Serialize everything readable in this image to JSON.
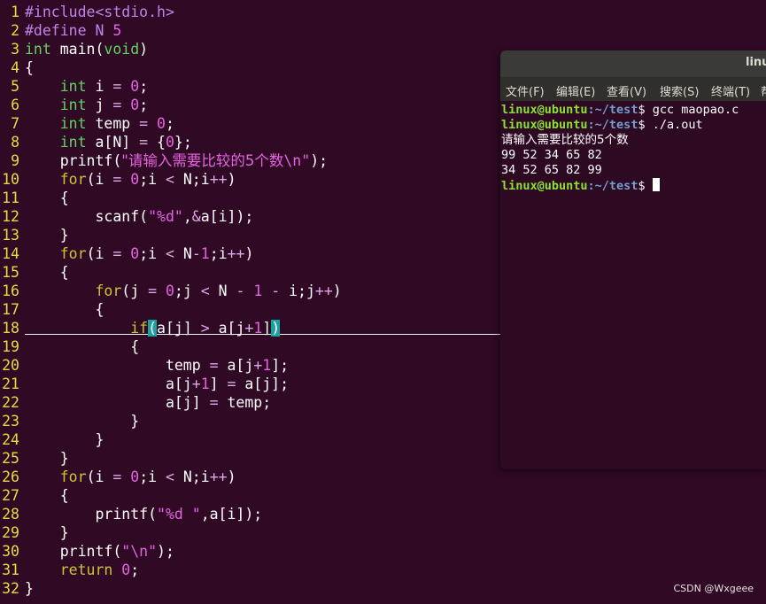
{
  "editor": {
    "line_numbers": [
      "1",
      "2",
      "3",
      "4",
      "5",
      "6",
      "7",
      "8",
      "9",
      "10",
      "11",
      "12",
      "13",
      "14",
      "15",
      "16",
      "17",
      "18",
      "19",
      "20",
      "21",
      "22",
      "23",
      "24",
      "25",
      "26",
      "27",
      "28",
      "29",
      "30",
      "31",
      "32"
    ],
    "code": {
      "l1": [
        "#include",
        "<stdio.h>"
      ],
      "l2": [
        "#define",
        " N ",
        "5"
      ],
      "l3": [
        "int",
        " main(",
        "void",
        ")"
      ],
      "l4": [
        "{"
      ],
      "l5": [
        "    ",
        "int",
        " i ",
        "=",
        " ",
        "0",
        ";"
      ],
      "l6": [
        "    ",
        "int",
        " j ",
        "=",
        " ",
        "0",
        ";"
      ],
      "l7": [
        "    ",
        "int",
        " temp ",
        "=",
        " ",
        "0",
        ";"
      ],
      "l8": [
        "    ",
        "int",
        " a[N] ",
        "=",
        " {",
        "0",
        "};"
      ],
      "l9": [
        "    printf(",
        "\"请输入需要比较的5个数",
        "\\n",
        "\"",
        ");"
      ],
      "l10": [
        "    ",
        "for",
        "(i ",
        "=",
        " ",
        "0",
        ";i ",
        "<",
        " N;i",
        "++",
        ")"
      ],
      "l11": [
        "    {"
      ],
      "l12": [
        "        scanf(",
        "\"%d\"",
        ",",
        "&",
        "a[i]);"
      ],
      "l13": [
        "    }"
      ],
      "l14": [
        "    ",
        "for",
        "(i ",
        "=",
        " ",
        "0",
        ";i ",
        "<",
        " N",
        "-",
        "1",
        ";i",
        "++",
        ")"
      ],
      "l15": [
        "    {"
      ],
      "l16": [
        "        ",
        "for",
        "(j ",
        "=",
        " ",
        "0",
        ";j ",
        "<",
        " N ",
        "-",
        " ",
        "1",
        " ",
        "-",
        " i;j",
        "++",
        ")"
      ],
      "l17": [
        "        {"
      ],
      "l18": [
        "            ",
        "if",
        "(",
        "a[j] ",
        ">",
        " a[j",
        "+",
        "1",
        "]",
        ")"
      ],
      "l19": [
        "            {"
      ],
      "l20": [
        "                temp ",
        "=",
        " a[j",
        "+",
        "1",
        "];"
      ],
      "l21": [
        "                a[j",
        "+",
        "1",
        "] ",
        "=",
        " a[j];"
      ],
      "l22": [
        "                a[j] ",
        "=",
        " temp;"
      ],
      "l23": [
        "            }"
      ],
      "l24": [
        "        }"
      ],
      "l25": [
        "    }"
      ],
      "l26": [
        "    ",
        "for",
        "(i ",
        "=",
        " ",
        "0",
        ";i ",
        "<",
        " N;i",
        "++",
        ")"
      ],
      "l27": [
        "    {"
      ],
      "l28": [
        "        printf(",
        "\"%d \"",
        ",a[i]);"
      ],
      "l29": [
        "    }"
      ],
      "l30": [
        "    printf(",
        "\"",
        "\\n",
        "\"",
        ");"
      ],
      "l31": [
        "    ",
        "return",
        " ",
        "0",
        ";"
      ],
      "l32": [
        "}"
      ]
    }
  },
  "terminal": {
    "title": "linu",
    "menu": [
      "文件(F)",
      "编辑(E)",
      "查看(V)",
      "搜索(S)",
      "终端(T)",
      "帮"
    ],
    "prompt_user": "linux@ubuntu",
    "prompt_path": ":~/test",
    "prompt_symbol": "$ ",
    "cmd1": "gcc maopao.c",
    "cmd2": "./a.out",
    "out1": "请输入需要比较的5个数",
    "out2": "99 52 34 65 82",
    "out3": "34 52 65 82 99"
  },
  "watermark": "CSDN @Wxgeee",
  "colors": {
    "background": "#300a24",
    "line_number": "#e8dc3c",
    "type": "#63d261",
    "keyword": "#c9c637",
    "number": "#e563e2",
    "preprocessor": "#c084ec",
    "prompt_user": "#8ae234",
    "prompt_path": "#729fcf",
    "match_highlight": "#1ea0a0"
  }
}
